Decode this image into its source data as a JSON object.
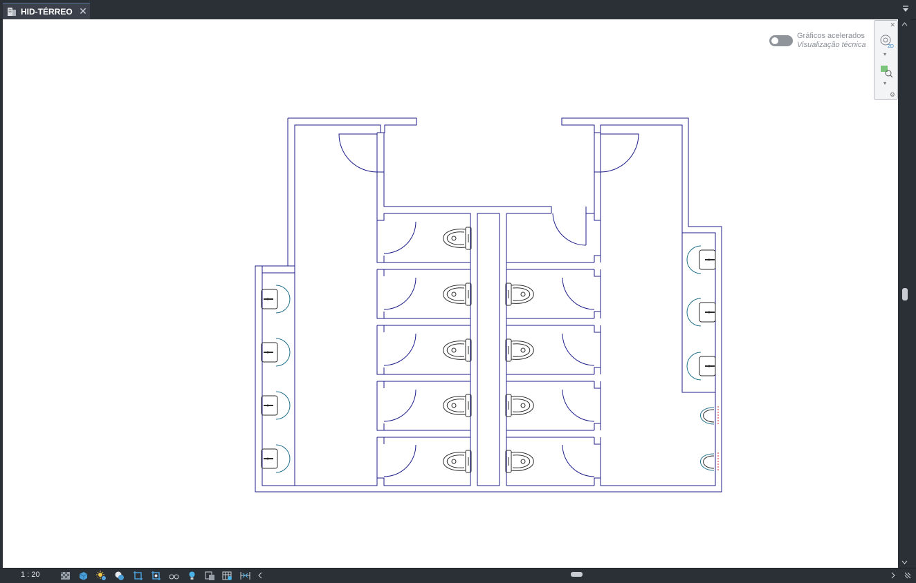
{
  "tab": {
    "title": "HID-TÉRREO",
    "icons": {
      "doc": "drawing-doc-icon",
      "close": "close-icon"
    }
  },
  "canvas_overlay": {
    "toggle_label": "Gráficos acelerados",
    "toggle_sublabel": "Visualização técnica",
    "toggle_on": false
  },
  "nav_panel": {
    "icons": [
      "close-icon",
      "2d-wheel-icon",
      "chevron-down-icon",
      "zoom-extents-icon",
      "chevron-down-icon",
      "settings-icon"
    ]
  },
  "status_bar": {
    "scale": "1 : 20",
    "icons": [
      "detail-level-icon",
      "visual-style-icon",
      "sun-path-icon",
      "shadows-icon",
      "crop-view-icon",
      "show-crop-icon",
      "temporary-hide-icon",
      "reveal-hidden-icon",
      "worksharing-icon",
      "analytical-model-icon",
      "highlight-displacement-icon"
    ]
  },
  "colors": {
    "wall": "#1c1c8a",
    "fixture": "#2a2a2a",
    "sink_outline": "#1f6f8b",
    "annotation_red": "#cc2a2a",
    "chrome_bg": "#2b2f36",
    "canvas_bg": "#ffffff"
  }
}
